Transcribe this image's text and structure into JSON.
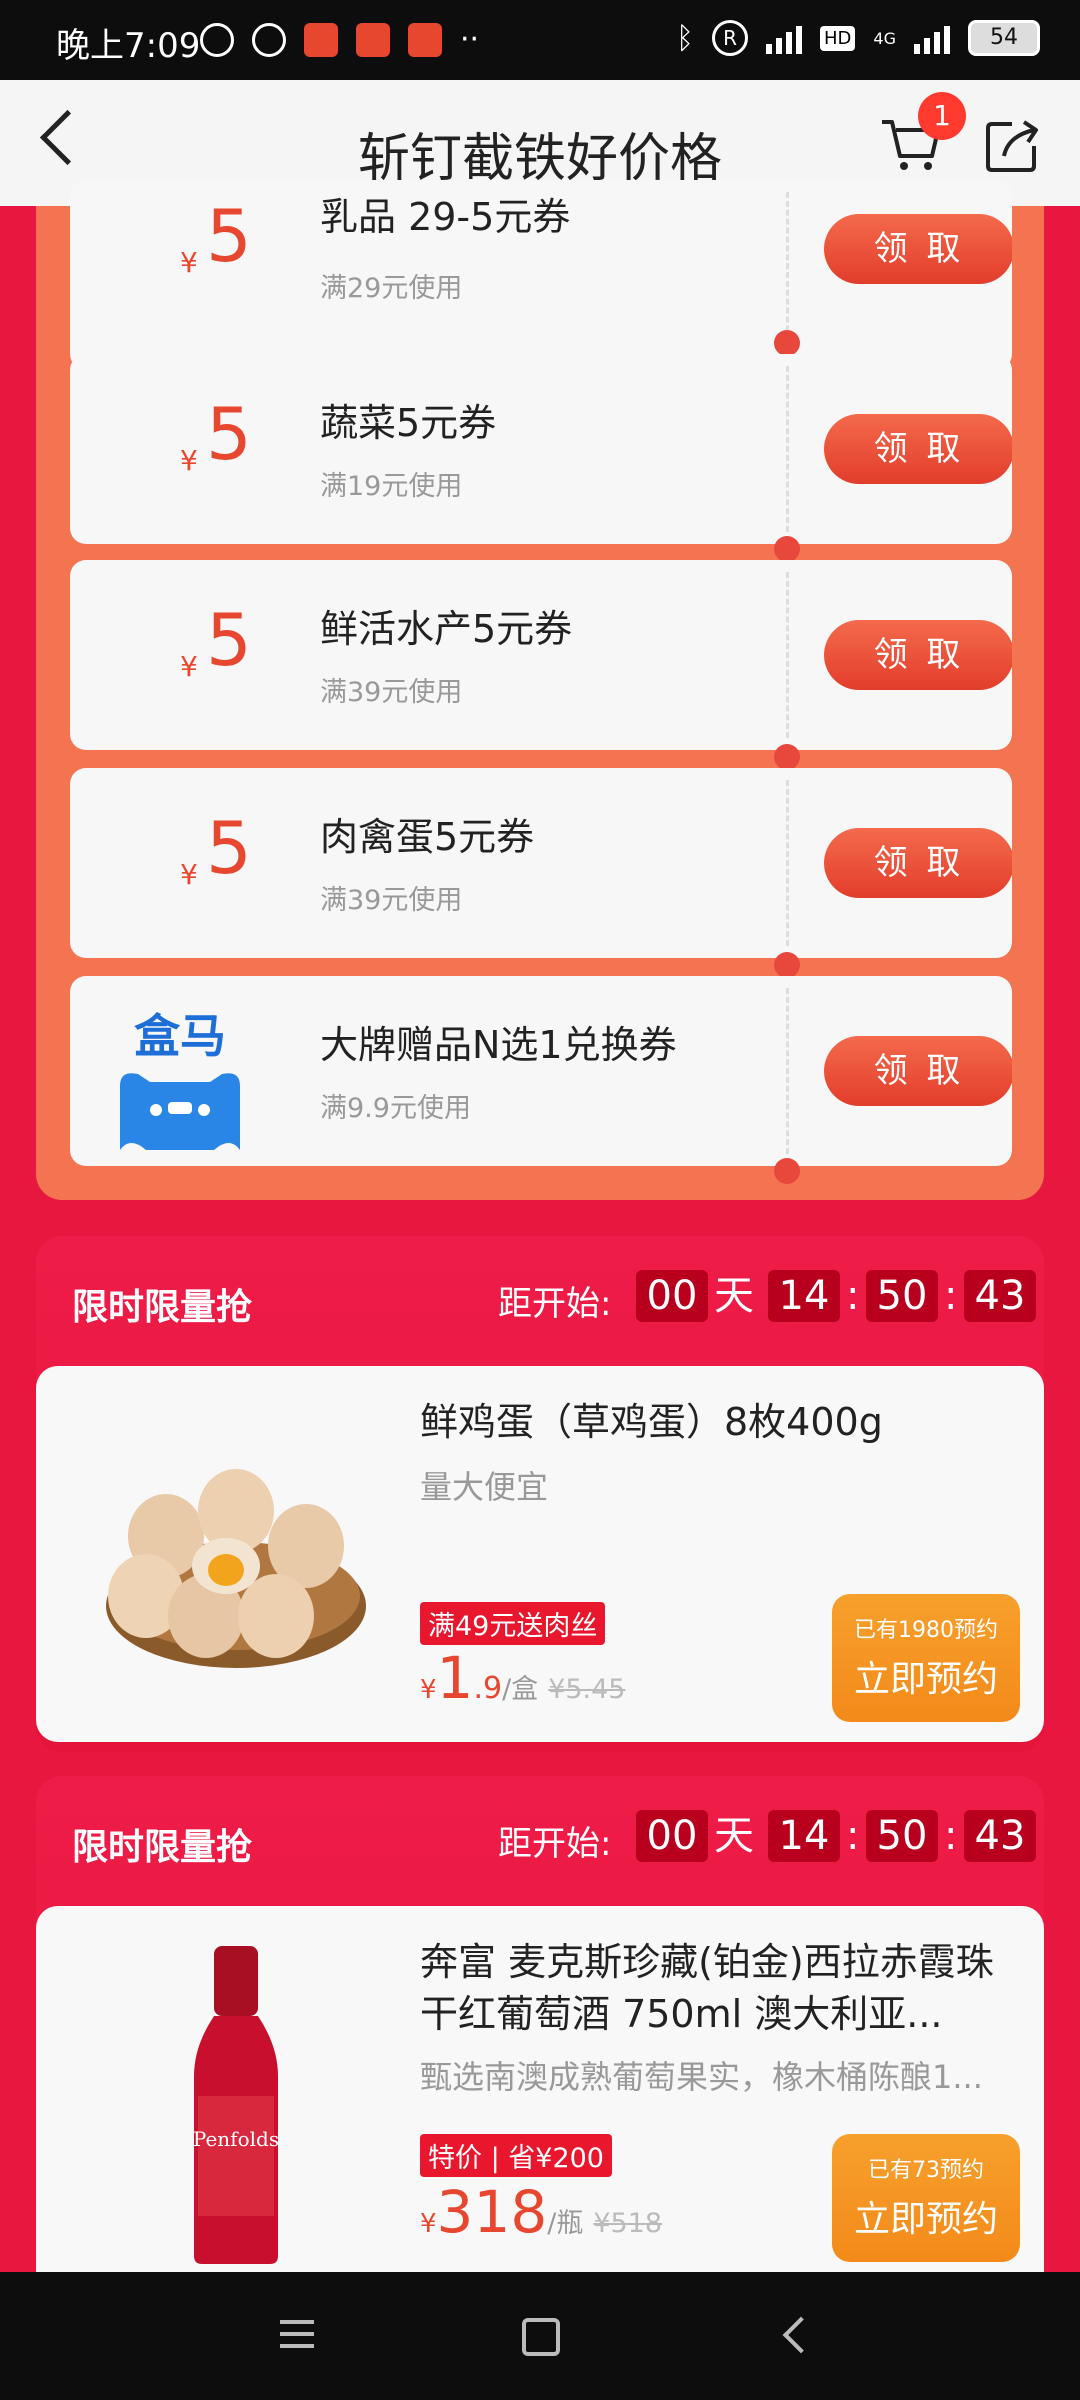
{
  "status_bar": {
    "time": "晚上7:09",
    "network": "4G",
    "hd": "HD",
    "battery": "54"
  },
  "header": {
    "title": "斩钉截铁好价格",
    "cart_badge": "1"
  },
  "coupons": [
    {
      "symbol": "¥",
      "amount": "5",
      "name": "乳品 29-5元券",
      "condition": "满29元使用",
      "button": "领 取"
    },
    {
      "symbol": "¥",
      "amount": "5",
      "name": "蔬菜5元券",
      "condition": "满19元使用",
      "button": "领 取"
    },
    {
      "symbol": "¥",
      "amount": "5",
      "name": "鲜活水产5元券",
      "condition": "满39元使用",
      "button": "领 取"
    },
    {
      "symbol": "¥",
      "amount": "5",
      "name": "肉禽蛋5元券",
      "condition": "满39元使用",
      "button": "领 取"
    },
    {
      "logo_text": "盒马",
      "name": "大牌赠品N选1兑换券",
      "condition": "满9.9元使用",
      "button": "领 取"
    }
  ],
  "flash_sales": [
    {
      "title": "限时限量抢",
      "start_label": "距开始:",
      "days": "00",
      "day_unit": "天",
      "hours": "14",
      "minutes": "50",
      "seconds": "43",
      "product": {
        "name": "鲜鸡蛋（草鸡蛋）8枚400g",
        "desc": "量大便宜",
        "tag": "满49元送肉丝",
        "currency": "¥",
        "price_int": "1",
        "price_dec": ".9",
        "unit": "/盒",
        "orig_price": "¥5.45",
        "reserved": "已有1980预约",
        "button": "立即预约",
        "image": "eggs"
      }
    },
    {
      "title": "限时限量抢",
      "start_label": "距开始:",
      "days": "00",
      "day_unit": "天",
      "hours": "14",
      "minutes": "50",
      "seconds": "43",
      "product": {
        "name": "奔富 麦克斯珍藏(铂金)西拉赤霞珠干红葡萄酒 750ml 澳大利亚...",
        "desc": "甄选南澳成熟葡萄果实，橡木桶陈酿1...",
        "tag": "特价 | 省¥200",
        "currency": "¥",
        "price_int": "318",
        "price_dec": "",
        "unit": "/瓶",
        "orig_price": "¥518",
        "reserved": "已有73预约",
        "button": "立即预约",
        "image": "wine-bottle"
      }
    }
  ]
}
